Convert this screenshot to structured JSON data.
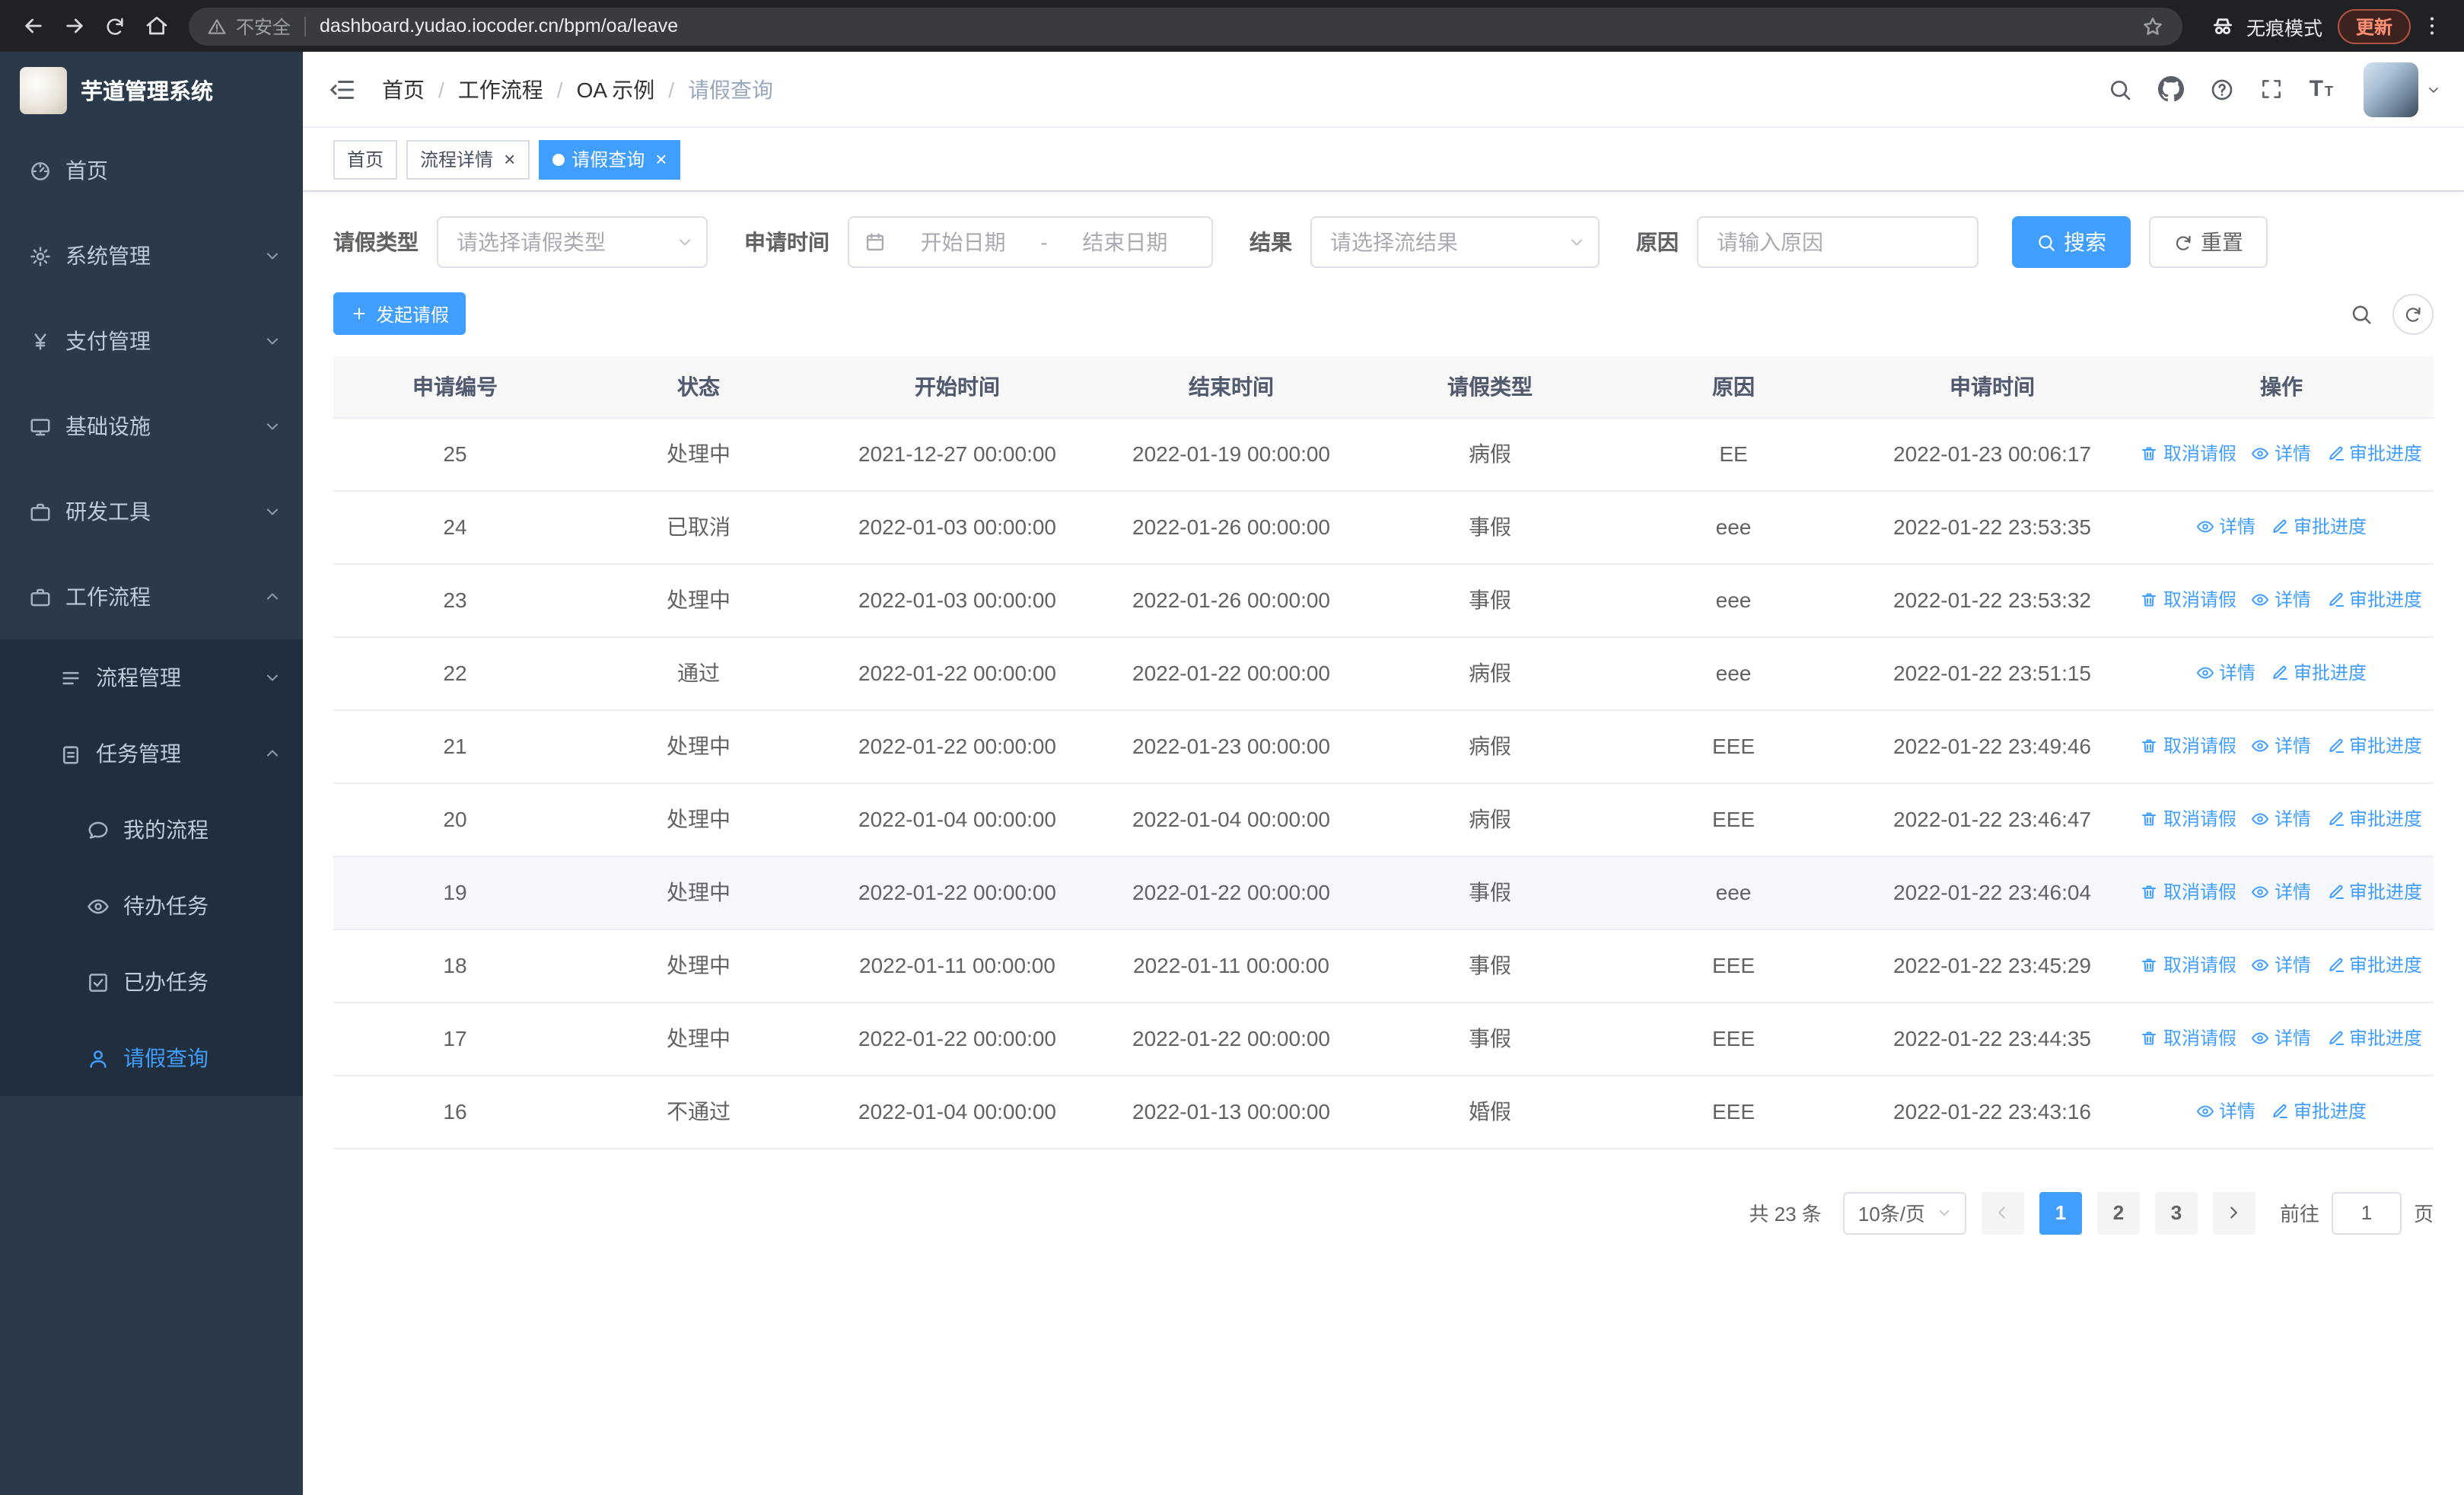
{
  "browser": {
    "security_label": "不安全",
    "url": "dashboard.yudao.iocoder.cn/bpm/oa/leave",
    "incognito_label": "无痕模式",
    "update_label": "更新"
  },
  "sidebar": {
    "logo_title": "芋道管理系统",
    "menu": [
      {
        "name": "home",
        "label": "首页",
        "icon": "dashboard-icon",
        "level": 1,
        "arrow": null,
        "active": false
      },
      {
        "name": "system",
        "label": "系统管理",
        "icon": "gear-icon",
        "level": 1,
        "arrow": "down",
        "active": false
      },
      {
        "name": "payment",
        "label": "支付管理",
        "icon": "yen-icon",
        "level": 1,
        "arrow": "down",
        "active": false
      },
      {
        "name": "infrastructure",
        "label": "基础设施",
        "icon": "monitor-icon",
        "level": 1,
        "arrow": "down",
        "active": false
      },
      {
        "name": "devtools",
        "label": "研发工具",
        "icon": "briefcase-icon",
        "level": 1,
        "arrow": "down",
        "active": false
      },
      {
        "name": "workflow",
        "label": "工作流程",
        "icon": "briefcase-icon",
        "level": 1,
        "arrow": "up",
        "active": false
      },
      {
        "name": "process-mgmt",
        "label": "流程管理",
        "icon": "list-icon",
        "level": 2,
        "arrow": "down",
        "active": false
      },
      {
        "name": "task-mgmt",
        "label": "任务管理",
        "icon": "clipboard-icon",
        "level": 2,
        "arrow": "up",
        "active": false
      },
      {
        "name": "my-process",
        "label": "我的流程",
        "icon": "chat-icon",
        "level": 3,
        "arrow": null,
        "active": false
      },
      {
        "name": "todo-tasks",
        "label": "待办任务",
        "icon": "eye-icon",
        "level": 3,
        "arrow": null,
        "active": false
      },
      {
        "name": "done-tasks",
        "label": "已办任务",
        "icon": "check-square-icon",
        "level": 3,
        "arrow": null,
        "active": false
      },
      {
        "name": "leave-query",
        "label": "请假查询",
        "icon": "user-icon",
        "level": 3,
        "arrow": null,
        "active": true
      }
    ]
  },
  "navbar": {
    "breadcrumb": [
      "首页",
      "工作流程",
      "OA 示例",
      "请假查询"
    ],
    "icons": [
      "search-icon",
      "github-icon",
      "question-icon",
      "fullscreen-icon",
      "font-size-icon"
    ]
  },
  "tabs": [
    {
      "name": "home",
      "label": "首页",
      "closable": false,
      "active": false
    },
    {
      "name": "process-detail",
      "label": "流程详情",
      "closable": true,
      "active": false
    },
    {
      "name": "leave-query",
      "label": "请假查询",
      "closable": true,
      "active": true
    }
  ],
  "filters": {
    "leave_type_label": "请假类型",
    "leave_type_placeholder": "请选择请假类型",
    "apply_time_label": "申请时间",
    "start_date_placeholder": "开始日期",
    "date_separator": "-",
    "end_date_placeholder": "结束日期",
    "result_label": "结果",
    "result_placeholder": "请选择流结果",
    "reason_label": "原因",
    "reason_placeholder": "请输入原因",
    "search_button": "搜索",
    "reset_button": "重置"
  },
  "toolbar": {
    "create_button": "发起请假"
  },
  "table": {
    "columns": [
      "申请编号",
      "状态",
      "开始时间",
      "结束时间",
      "请假类型",
      "原因",
      "申请时间",
      "操作"
    ],
    "action_defs": {
      "cancel": {
        "label": "取消请假",
        "icon": "trash-icon",
        "name": "cancel-leave-link"
      },
      "detail": {
        "label": "详情",
        "icon": "eye-icon",
        "name": "detail-link"
      },
      "progress": {
        "label": "审批进度",
        "icon": "edit-icon",
        "name": "approval-progress-link"
      }
    },
    "rows": [
      {
        "id": "25",
        "status": "处理中",
        "start": "2021-12-27 00:00:00",
        "end": "2022-01-19 00:00:00",
        "type": "病假",
        "reason": "EE",
        "applied": "2022-01-23 00:06:17",
        "actions": [
          "cancel",
          "detail",
          "progress"
        ],
        "hover": false
      },
      {
        "id": "24",
        "status": "已取消",
        "start": "2022-01-03 00:00:00",
        "end": "2022-01-26 00:00:00",
        "type": "事假",
        "reason": "eee",
        "applied": "2022-01-22 23:53:35",
        "actions": [
          "detail",
          "progress"
        ],
        "hover": false
      },
      {
        "id": "23",
        "status": "处理中",
        "start": "2022-01-03 00:00:00",
        "end": "2022-01-26 00:00:00",
        "type": "事假",
        "reason": "eee",
        "applied": "2022-01-22 23:53:32",
        "actions": [
          "cancel",
          "detail",
          "progress"
        ],
        "hover": false
      },
      {
        "id": "22",
        "status": "通过",
        "start": "2022-01-22 00:00:00",
        "end": "2022-01-22 00:00:00",
        "type": "病假",
        "reason": "eee",
        "applied": "2022-01-22 23:51:15",
        "actions": [
          "detail",
          "progress"
        ],
        "hover": false
      },
      {
        "id": "21",
        "status": "处理中",
        "start": "2022-01-22 00:00:00",
        "end": "2022-01-23 00:00:00",
        "type": "病假",
        "reason": "EEE",
        "applied": "2022-01-22 23:49:46",
        "actions": [
          "cancel",
          "detail",
          "progress"
        ],
        "hover": false
      },
      {
        "id": "20",
        "status": "处理中",
        "start": "2022-01-04 00:00:00",
        "end": "2022-01-04 00:00:00",
        "type": "病假",
        "reason": "EEE",
        "applied": "2022-01-22 23:46:47",
        "actions": [
          "cancel",
          "detail",
          "progress"
        ],
        "hover": false
      },
      {
        "id": "19",
        "status": "处理中",
        "start": "2022-01-22 00:00:00",
        "end": "2022-01-22 00:00:00",
        "type": "事假",
        "reason": "eee",
        "applied": "2022-01-22 23:46:04",
        "actions": [
          "cancel",
          "detail",
          "progress"
        ],
        "hover": true
      },
      {
        "id": "18",
        "status": "处理中",
        "start": "2022-01-11 00:00:00",
        "end": "2022-01-11 00:00:00",
        "type": "事假",
        "reason": "EEE",
        "applied": "2022-01-22 23:45:29",
        "actions": [
          "cancel",
          "detail",
          "progress"
        ],
        "hover": false
      },
      {
        "id": "17",
        "status": "处理中",
        "start": "2022-01-22 00:00:00",
        "end": "2022-01-22 00:00:00",
        "type": "事假",
        "reason": "EEE",
        "applied": "2022-01-22 23:44:35",
        "actions": [
          "cancel",
          "detail",
          "progress"
        ],
        "hover": false
      },
      {
        "id": "16",
        "status": "不通过",
        "start": "2022-01-04 00:00:00",
        "end": "2022-01-13 00:00:00",
        "type": "婚假",
        "reason": "EEE",
        "applied": "2022-01-22 23:43:16",
        "actions": [
          "detail",
          "progress"
        ],
        "hover": false
      }
    ]
  },
  "pagination": {
    "total_text": "共 23 条",
    "page_size": "10条/页",
    "pages": [
      "1",
      "2",
      "3"
    ],
    "active_page": "1",
    "goto_label": "前往",
    "goto_value": "1",
    "goto_suffix": "页"
  },
  "colors": {
    "primary": "#409eff",
    "sidebar_bg": "#2b3a4a",
    "sidebar_sub_bg": "#212e3d",
    "sidebar_text": "#bfcbd9"
  }
}
